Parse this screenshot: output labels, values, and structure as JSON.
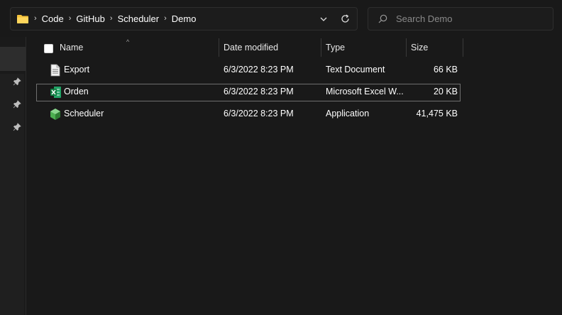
{
  "breadcrumbs": [
    "Code",
    "GitHub",
    "Scheduler",
    "Demo"
  ],
  "search": {
    "placeholder": "Search Demo"
  },
  "columns": {
    "name": "Name",
    "date_modified": "Date modified",
    "type": "Type",
    "size": "Size"
  },
  "files": [
    {
      "name": "Export",
      "date_modified": "6/3/2022 8:23 PM",
      "type": "Text Document",
      "size": "66 KB",
      "icon": "text-document-icon"
    },
    {
      "name": "Orden",
      "date_modified": "6/3/2022 8:23 PM",
      "type": "Microsoft Excel W...",
      "size": "20 KB",
      "icon": "excel-file-icon"
    },
    {
      "name": "Scheduler",
      "date_modified": "6/3/2022 8:23 PM",
      "type": "Application",
      "size": "41,475 KB",
      "icon": "application-icon"
    }
  ],
  "icons": {
    "folder": "folder-icon",
    "dropdown": "chevron-down-icon",
    "refresh": "refresh-icon",
    "search": "search-icon",
    "pin": "pin-icon"
  },
  "colors": {
    "background": "#191919",
    "folder_yellow": "#f3c13a",
    "excel_green": "#1d7044",
    "app_green": "#5cb85c"
  }
}
